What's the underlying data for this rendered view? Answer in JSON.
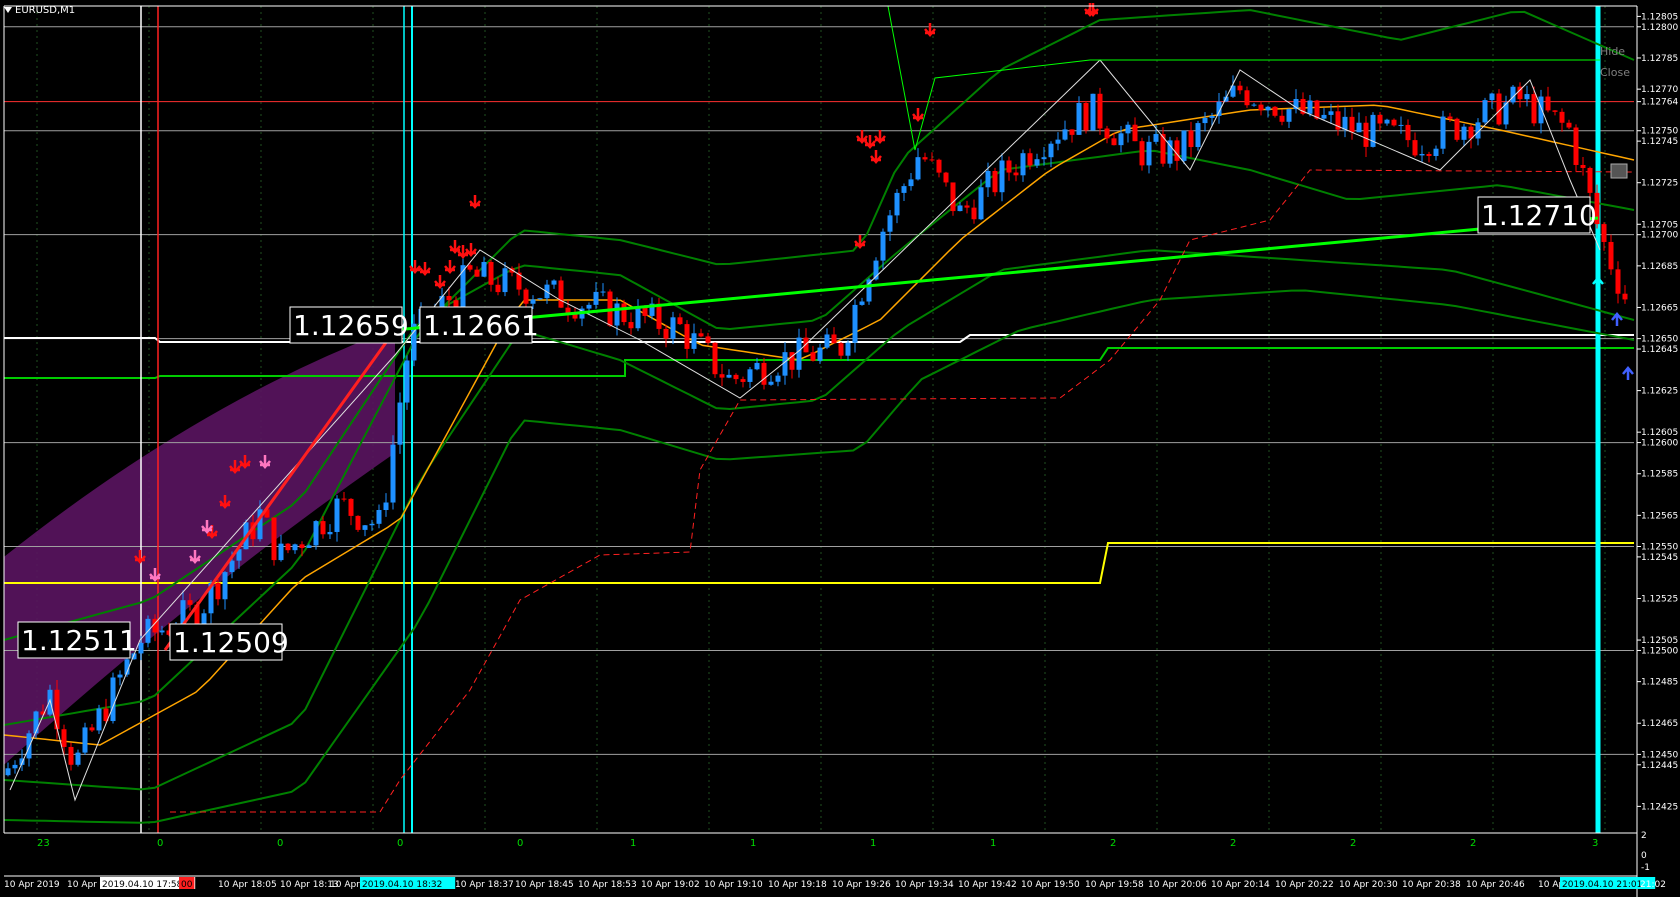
{
  "symbol": "EURUSD,M1",
  "panel": {
    "hide": "Hide",
    "close": "Close"
  },
  "colors": {
    "bg": "#000000",
    "bull": "#1e90ff",
    "bear": "#ff0000",
    "grid": "#1f4f1f",
    "ma": "#ffa500",
    "band": "#008000",
    "hline_yellow": "#ffff00",
    "hline_green": "#00cc00",
    "hline_white": "#ffffff",
    "trend": "#00ff00",
    "cursor": "#00ffff",
    "envelope": "#5a1460"
  },
  "chart_data": {
    "type": "candlestick",
    "title": "EURUSD,M1",
    "ylim": [
      1.12417,
      1.1281
    ],
    "price_ticks": [
      "1.12805",
      "1.12800",
      "1.12785",
      "1.12770",
      "1.12764",
      "1.12750",
      "1.12745",
      "1.12725",
      "1.12705",
      "1.12700",
      "1.12685",
      "1.12665",
      "1.12650",
      "1.12645",
      "1.12625",
      "1.12605",
      "1.12600",
      "1.12585",
      "1.12565",
      "1.12550",
      "1.12545",
      "1.12525",
      "1.12505",
      "1.12500",
      "1.12485",
      "1.12465",
      "1.12450",
      "1.12445",
      "1.12425"
    ],
    "time_labels": [
      "10 Apr 2019",
      "10 Apr",
      "2019.04.10 17:58",
      "00",
      "10 Apr 18:05",
      "10 Apr 18:13",
      "10 Apr 18",
      "2019.04.10 18:32",
      "10 Apr 18:37",
      "10 Apr 18:45",
      "10 Apr 18:53",
      "10 Apr 19:02",
      "10 Apr 19:10",
      "10 Apr 19:18",
      "10 Apr 19:26",
      "10 Apr 19:34",
      "10 Apr 19:42",
      "10 Apr 19:50",
      "10 Apr 19:58",
      "10 Apr 20:06",
      "10 Apr 20:14",
      "10 Apr 20:22",
      "10 Apr 20:30",
      "10 Apr 20:38",
      "10 Apr 20:46",
      "10 Apr 2",
      "2019.04.10 21:01",
      "21:02"
    ],
    "subpanel_labels": [
      "23",
      "0",
      "0",
      "0",
      "0",
      "1",
      "1",
      "1",
      "1",
      "2",
      "2",
      "2",
      "2",
      "3"
    ],
    "subpanel_scale": [
      "2",
      "0",
      "-1"
    ],
    "price_labels": [
      "1.12511",
      "1.12509",
      "1.12659",
      "1.12661",
      "1.12710"
    ],
    "bid_line": 1.12764,
    "levels": {
      "white": [
        1.128,
        1.1275,
        1.127,
        1.1265,
        1.126,
        1.1255,
        1.125,
        1.1245
      ]
    },
    "series": [
      {
        "kind": "candles"
      },
      {
        "kind": "moving_average"
      },
      {
        "kind": "bands"
      }
    ]
  }
}
